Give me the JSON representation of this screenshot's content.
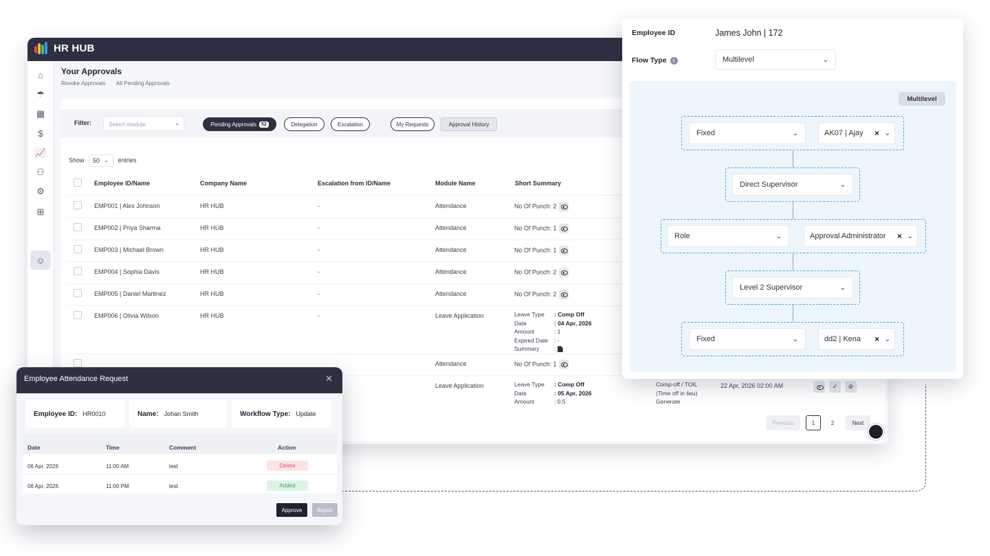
{
  "app": {
    "brand": "HR HUB",
    "page_title": "Your Approvals",
    "breadcrumbs": [
      "Revoke Approvals",
      "All Pending Approvals"
    ]
  },
  "filter": {
    "label": "Filter:",
    "module_placeholder": "Select module",
    "tabs": {
      "pending": "Pending Approvals",
      "pending_count": "52",
      "delegation": "Delegation",
      "escalation": "Escalation",
      "my_requests": "My Requests",
      "approval_history": "Approval History"
    }
  },
  "entries": {
    "show": "Show",
    "count": "50",
    "entries": "entries"
  },
  "table": {
    "headers": [
      "Employee ID/Name",
      "Company Name",
      "Escalation from ID/Name",
      "Module Name",
      "Short Summary"
    ],
    "rows": [
      {
        "emp": "EMP001 | Alex Johnson",
        "company": "HR HUB",
        "esc": "-",
        "module": "Attendance",
        "summary": "No Of Punch: 2"
      },
      {
        "emp": "EMP002 | Priya Sharma",
        "company": "HR HUB",
        "esc": "-",
        "module": "Attendance",
        "summary": "No Of Punch: 1"
      },
      {
        "emp": "EMP003 | Michael Brown",
        "company": "HR HUB",
        "esc": "-",
        "module": "Attendance",
        "summary": "No Of Punch: 1"
      },
      {
        "emp": "EMP004 | Sophia Davis",
        "company": "HR HUB",
        "esc": "-",
        "module": "Attendance",
        "summary": "No Of Punch: 2"
      },
      {
        "emp": "EMP005 | Daniel Martinez",
        "company": "HR HUB",
        "esc": "-",
        "module": "Attendance",
        "summary": "No Of Punch: 2"
      },
      {
        "emp": "EMP006 | Olivia Wilson",
        "company": "HR HUB",
        "esc": "-",
        "module": "Leave Application",
        "leave": {
          "type_label": "Leave Type",
          "type": ": Comp Off",
          "date_label": "Date",
          "date": ": 04 Apr, 2026",
          "amount_label": "Amount",
          "amount": ": 1",
          "expired_label": "Expired Date",
          "expired": ": -",
          "summary_label": "Summary",
          "summary": ":"
        }
      },
      {
        "module": "Attendance",
        "summary": "No Of Punch: 1"
      },
      {
        "module": "Leave Application",
        "leave": {
          "type_label": "Leave Type",
          "type": ": Comp Off",
          "date_label": "Date",
          "date": ": 05 Apr, 2026",
          "amount_label": "Amount",
          "amount": ": 0.5"
        },
        "request_type": [
          "Comp-off / TOIL",
          "(Time off in lieu)",
          "Generate"
        ],
        "datetime": "22 Apr, 2026 02:00 AM"
      }
    ]
  },
  "pagination": {
    "previous": "Previous",
    "pages": [
      "1",
      "2"
    ],
    "next": "Next"
  },
  "flow": {
    "employee_label": "Employee ID",
    "employee_value": "James John | 172",
    "flow_type_label": "Flow Type",
    "flow_type_value": "Multilevel",
    "tag": "Multilevel",
    "levels": [
      {
        "left": "Fixed",
        "right": "AK07 | Ajay"
      },
      {
        "left": "Direct Supervisor"
      },
      {
        "left": "Role",
        "right": "Approval Administrator"
      },
      {
        "left": "Level 2 Supervisor"
      },
      {
        "left": "Fixed",
        "right": "dd2 | Kena"
      }
    ]
  },
  "modal": {
    "title": "Employee Attendance Request",
    "employee_label": "Employee ID:",
    "employee_value": "HR0010",
    "name_label": "Name:",
    "name_value": "Johan Smith",
    "workflow_label": "Workflow Type:",
    "workflow_value": "Update",
    "headers": [
      "Date",
      "Time",
      "Comment",
      "Action"
    ],
    "rows": [
      {
        "date": "06 Apr, 2026",
        "time": "11:00 AM",
        "comment": "test",
        "action": "Delete"
      },
      {
        "date": "06 Apr, 2026",
        "time": "11:00 PM",
        "comment": "test",
        "action": "Added"
      }
    ],
    "approve": "Approve",
    "reject": "Reject"
  },
  "colors": {
    "brand_dark": "#2e3042",
    "flow_area": "#eef6fd",
    "dashed_border": "#4aa8d8",
    "delete_tag": "#fde3e6",
    "added_tag": "#dff3e4"
  }
}
